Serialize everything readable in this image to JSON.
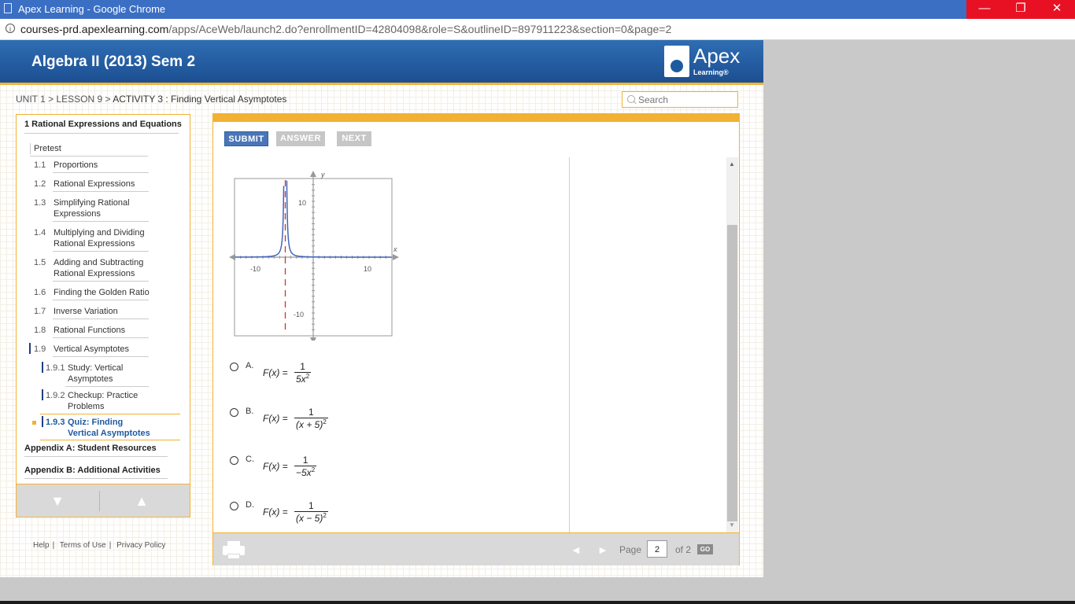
{
  "window": {
    "title": "Apex Learning - Google Chrome",
    "min_glyph": "—",
    "max_glyph": "❐",
    "close_glyph": "✕"
  },
  "browser": {
    "info_glyph": "i",
    "url_host": "courses-prd.apexlearning.com",
    "url_path": "/apps/AceWeb/launch2.do?enrollmentID=42804098&role=S&outlineID=897911223&section=0&page=2"
  },
  "header": {
    "course_title": "Algebra II (2013) Sem 2",
    "logo_word": "Apex",
    "logo_sub": "Learning®"
  },
  "breadcrumb": {
    "unit": "UNIT 1",
    "sep1": " > ",
    "lesson": "LESSON 9",
    "sep2": " > ",
    "activity": "ACTIVITY 3 : Finding Vertical Asymptotes"
  },
  "search": {
    "placeholder": "Search"
  },
  "sidebar": {
    "section_title": "1   Rational Expressions and Equations",
    "pretest": "Pretest",
    "items": [
      {
        "num": "1.1",
        "label": "Proportions"
      },
      {
        "num": "1.2",
        "label": "Rational Expressions"
      },
      {
        "num": "1.3",
        "label": "Simplifying Rational Expressions"
      },
      {
        "num": "1.4",
        "label": "Multiplying and Dividing Rational Expressions"
      },
      {
        "num": "1.5",
        "label": "Adding and Subtracting Rational Expressions"
      },
      {
        "num": "1.6",
        "label": "Finding the Golden Ratio"
      },
      {
        "num": "1.7",
        "label": "Inverse Variation"
      },
      {
        "num": "1.8",
        "label": "Rational Functions"
      },
      {
        "num": "1.9",
        "label": "Vertical Asymptotes"
      }
    ],
    "subitems": [
      {
        "num": "1.9.1",
        "label": "Study: Vertical Asymptotes"
      },
      {
        "num": "1.9.2",
        "label": "Checkup: Practice Problems"
      },
      {
        "num": "1.9.3",
        "label": "Quiz: Finding Vertical Asymptotes"
      }
    ],
    "appendix_a": "Appendix A: Student Resources",
    "appendix_b": "Appendix B: Additional Activities",
    "nav_down": "▼",
    "nav_up": "▲"
  },
  "footer": {
    "help": "Help",
    "sep": "|",
    "terms": "Terms of Use",
    "privacy": "Privacy Policy"
  },
  "content": {
    "buttons": {
      "submit": "SUBMIT",
      "answer": "ANSWER",
      "next": "NEXT"
    },
    "graph": {
      "y_label": "y",
      "x_label": "x",
      "y_tick_top": "10",
      "y_tick_bottom": "-10",
      "x_tick_left": "-10",
      "x_tick_right": "10",
      "x_range": [
        -14,
        14
      ],
      "y_range": [
        -14,
        14
      ],
      "asymptote_x": -5,
      "curve_color": "#4466bb",
      "asymptote_color": "#cc3333"
    },
    "options": [
      {
        "letter": "A.",
        "fx": "F(x) = ",
        "numer": "1",
        "denom": "5x",
        "exp": "2"
      },
      {
        "letter": "B.",
        "fx": "F(x) = ",
        "numer": "1",
        "denom": "(x + 5)",
        "exp": "2"
      },
      {
        "letter": "C.",
        "fx": "F(x) = ",
        "numer": "1",
        "denom": "−5x",
        "exp": "2"
      },
      {
        "letter": "D.",
        "fx": "F(x) = ",
        "numer": "1",
        "denom": "(x − 5)",
        "exp": "2"
      }
    ],
    "pager": {
      "page_label": "Page",
      "page_value": "2",
      "of_label": "of 2",
      "go": "GO",
      "prev": "◄",
      "next": "►"
    },
    "scroll_up": "▲",
    "scroll_down": "▼"
  }
}
